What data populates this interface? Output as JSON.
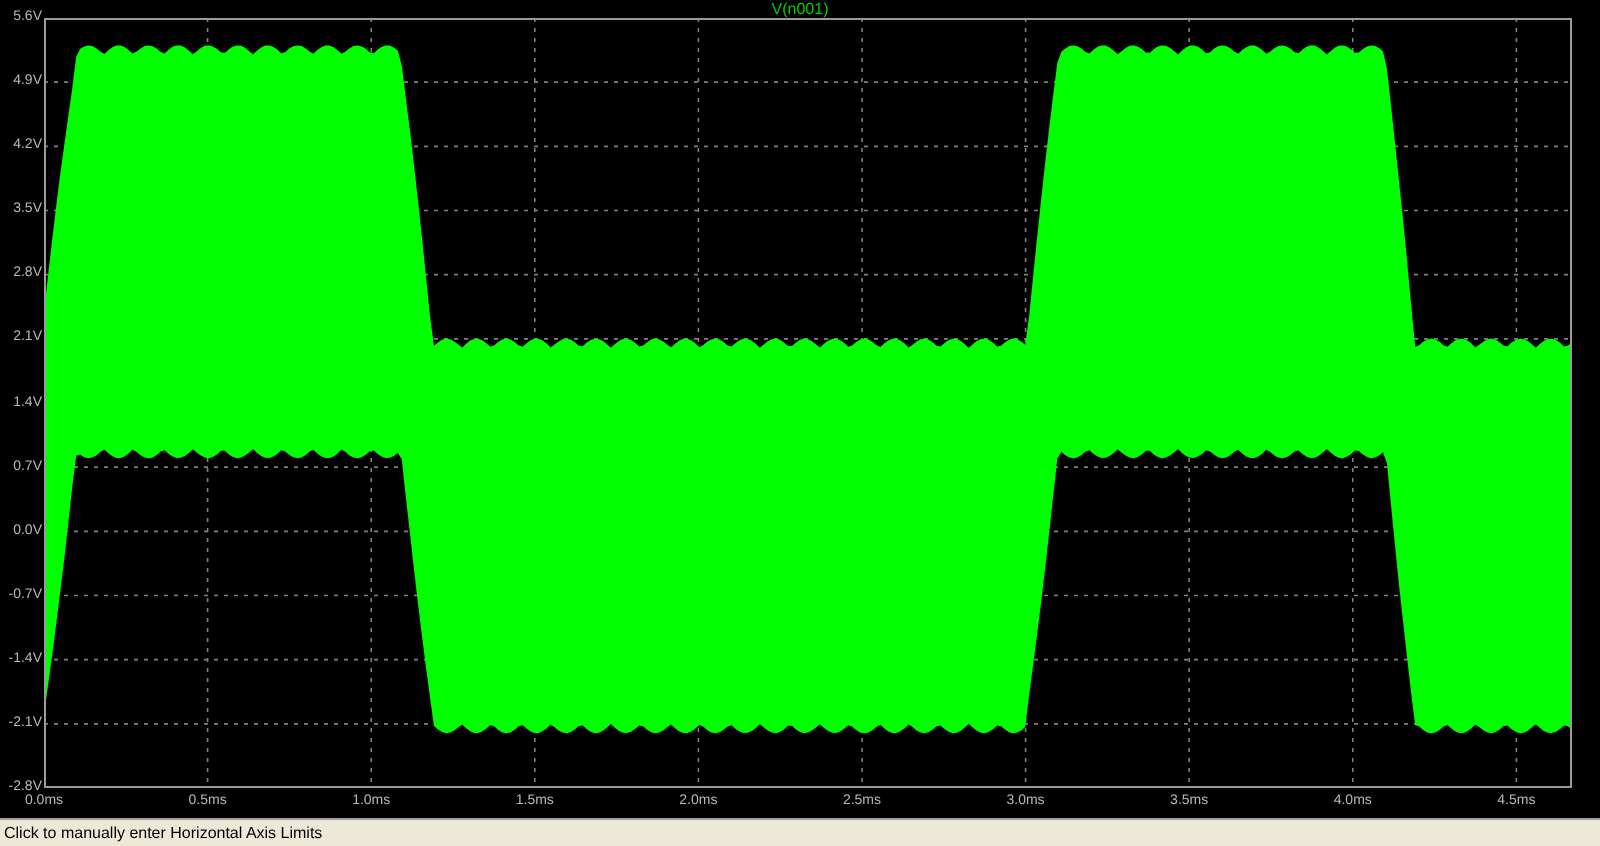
{
  "plot": {
    "trace_label": "V(n001)",
    "y_ticks": [
      "5.6V",
      "4.9V",
      "4.2V",
      "3.5V",
      "2.8V",
      "2.1V",
      "1.4V",
      "0.7V",
      "0.0V",
      "-0.7V",
      "-1.4V",
      "-2.1V",
      "-2.8V"
    ],
    "x_ticks": [
      "0.0ms",
      "0.5ms",
      "1.0ms",
      "1.5ms",
      "2.0ms",
      "2.5ms",
      "3.0ms",
      "3.5ms",
      "4.0ms",
      "4.5ms"
    ]
  },
  "status_bar": {
    "text": "Click to manually enter Horizontal Axis Limits"
  }
}
